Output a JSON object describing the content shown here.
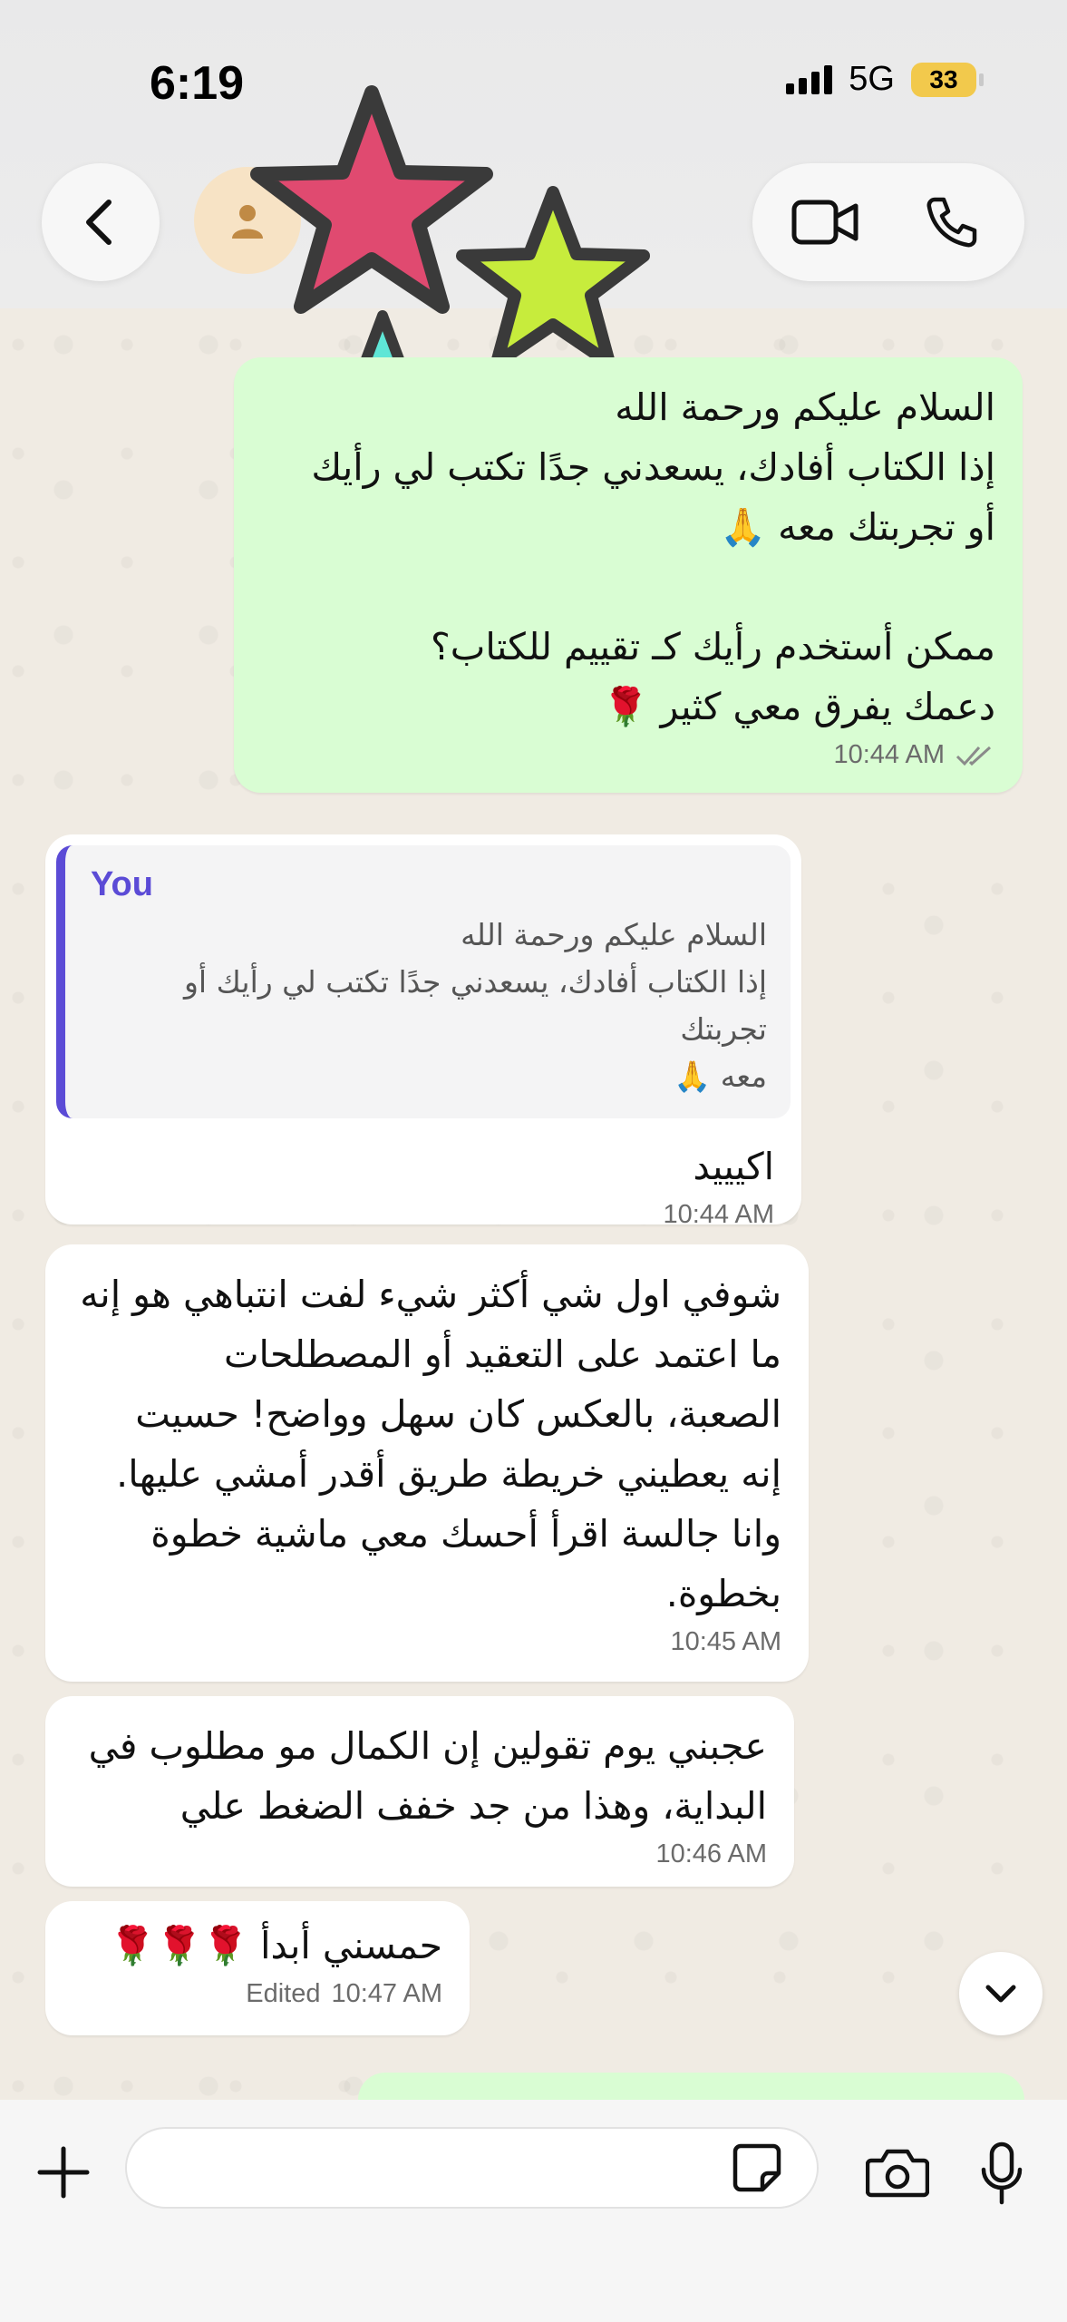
{
  "status_bar": {
    "time": "6:19",
    "network": "5G",
    "battery": "33"
  },
  "header": {
    "back_icon": "chevron-left-icon",
    "avatar_icon": "person-icon",
    "video_icon": "video-camera-icon",
    "call_icon": "phone-icon"
  },
  "messages": [
    {
      "direction": "out",
      "text": "السلام عليكم ورحمة الله\nإذا الكتاب أفادك، يسعدني جدًا تكتب لي رأيك\nأو تجربتك معه 🙏\n\nممكن أستخدم رأيك كـ تقييم للكتاب؟\nدعمك يفرق معي كثير 🌹",
      "time": "10:44 AM",
      "status_icon": "double-check-icon"
    },
    {
      "direction": "in",
      "quote_author": "You",
      "quote_text": "السلام عليكم ورحمة الله\nإذا الكتاب أفادك، يسعدني جدًا تكتب لي رأيك أو تجربتك\nمعه 🙏",
      "text": "اكيييد",
      "time": "10:44 AM"
    },
    {
      "direction": "in",
      "text": "شوفي اول شي أكثر شيء لفت انتباهي هو إنه\nما اعتمد على التعقيد أو المصطلحات\nالصعبة، بالعكس كان سهل وواضح! حسيت\nإنه يعطيني خريطة طريق أقدر أمشي عليها.\nوانا جالسة اقرأ أحسك معي ماشية خطوة\nبخطوة.",
      "time": "10:45 AM"
    },
    {
      "direction": "in",
      "text": "عجبني يوم تقولين إن الكمال مو مطلوب في\nالبداية، وهذا من جد خفف الضغط علي",
      "time": "10:46 AM"
    },
    {
      "direction": "in",
      "text": "حمسني أبدأ 🌹🌹🌹",
      "edited": "Edited",
      "time": "10:47 AM"
    }
  ],
  "input_bar": {
    "placeholder": "",
    "plus_icon": "plus-icon",
    "sticker_icon": "sticker-icon",
    "camera_icon": "camera-icon",
    "mic_icon": "microphone-icon"
  },
  "colors": {
    "outgoing_bubble": "#d9fdd3",
    "incoming_bubble": "#ffffff",
    "quote_accent": "#5b4bd6",
    "battery": "#f2c94c"
  }
}
